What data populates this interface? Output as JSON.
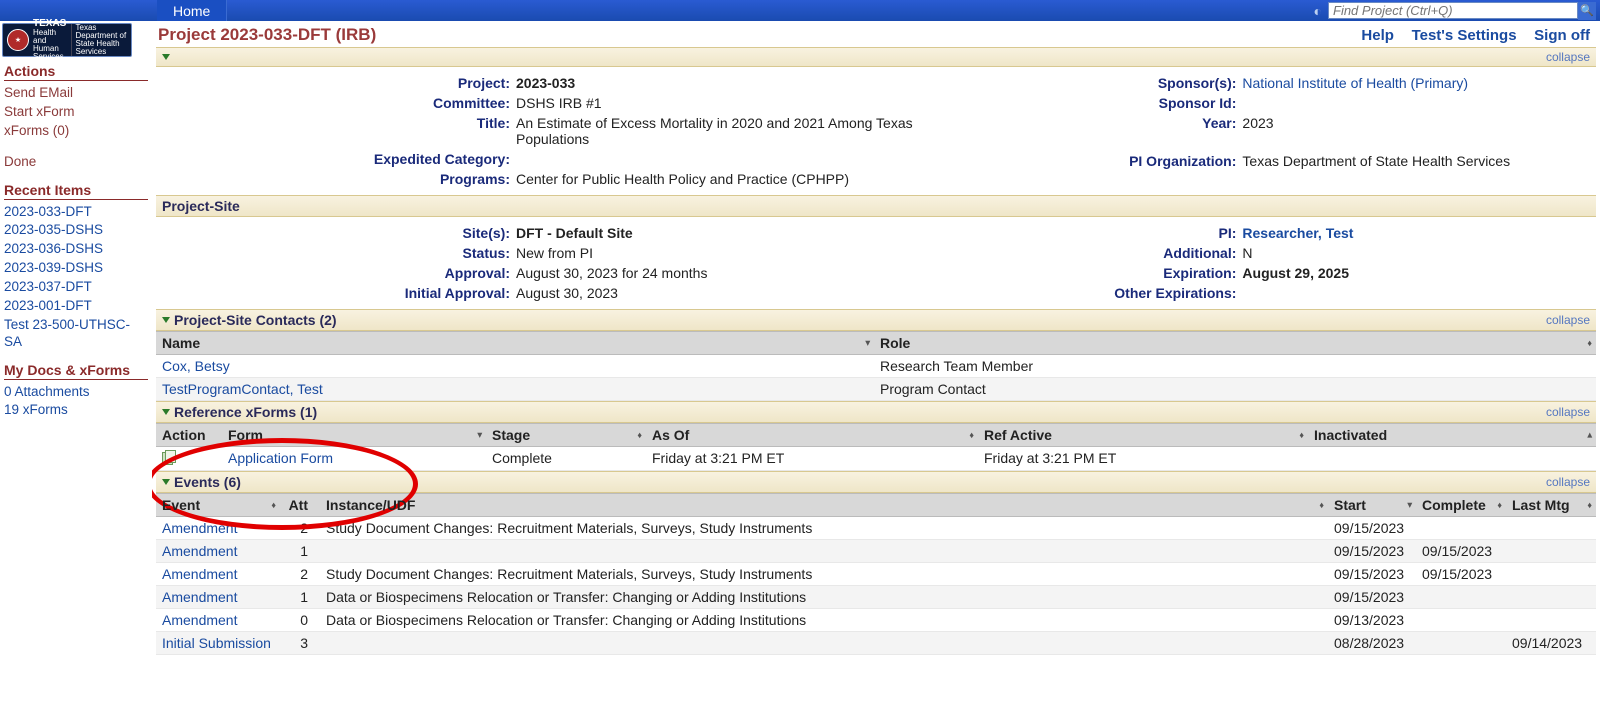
{
  "topbar": {
    "home": "Home",
    "search_placeholder": "Find Project (Ctrl+Q)"
  },
  "logo": {
    "line1": "TEXAS",
    "line2": "Health and Human Services",
    "line3": "Texas Department of State Health Services"
  },
  "titlebar": {
    "title": "Project 2023-033-DFT (IRB)",
    "help": "Help",
    "settings": "Test's Settings",
    "signoff": "Sign off"
  },
  "sidebar": {
    "actions_header": "Actions",
    "actions": [
      "Send EMail",
      "Start xForm",
      "xForms (0)",
      "Done"
    ],
    "recent_header": "Recent Items",
    "recent": [
      "2023-033-DFT",
      "2023-035-DSHS",
      "2023-036-DSHS",
      "2023-039-DSHS",
      "2023-037-DFT",
      "2023-001-DFT",
      "Test 23-500-UTHSC-SA"
    ],
    "docs_header": "My Docs & xForms",
    "docs": [
      "0 Attachments",
      "19 xForms"
    ]
  },
  "collapse_label": "collapse",
  "project": {
    "labels": {
      "project": "Project:",
      "committee": "Committee:",
      "title": "Title:",
      "expedited": "Expedited Category:",
      "programs": "Programs:",
      "sponsors": "Sponsor(s):",
      "sponsor_id": "Sponsor Id:",
      "year": "Year:",
      "pi_org": "PI Organization:"
    },
    "project": "2023-033",
    "committee": "DSHS IRB #1",
    "title": "An Estimate of Excess Mortality in 2020 and 2021 Among Texas Populations",
    "expedited": "",
    "programs": "Center for Public Health Policy and Practice (CPHPP)",
    "sponsors": "National Institute of Health (Primary)",
    "sponsor_id": "",
    "year": "2023",
    "pi_org": "Texas Department of State Health Services"
  },
  "project_site_header": "Project-Site",
  "site": {
    "labels": {
      "sites": "Site(s):",
      "status": "Status:",
      "approval": "Approval:",
      "initial": "Initial Approval:",
      "pi": "PI:",
      "additional": "Additional:",
      "expiration": "Expiration:",
      "other_exp": "Other Expirations:"
    },
    "sites": "DFT - Default Site",
    "status": "New from PI",
    "approval": "August 30, 2023 for 24 months",
    "initial": "August 30, 2023",
    "pi": "Researcher, Test",
    "additional": "N",
    "expiration": "August 29, 2025",
    "other_exp": ""
  },
  "contacts": {
    "header": "Project-Site Contacts (2)",
    "cols": {
      "name": "Name",
      "role": "Role"
    },
    "rows": [
      {
        "name": "Cox, Betsy",
        "role": "Research Team Member"
      },
      {
        "name": "TestProgramContact, Test",
        "role": "Program Contact"
      }
    ]
  },
  "refforms": {
    "header": "Reference xForms (1)",
    "cols": {
      "action": "Action",
      "form": "Form",
      "stage": "Stage",
      "asof": "As Of",
      "refactive": "Ref Active",
      "inactivated": "Inactivated"
    },
    "rows": [
      {
        "form": "Application Form",
        "stage": "Complete",
        "asof": "Friday at 3:21 PM ET",
        "refactive": "Friday at 3:21 PM ET",
        "inactivated": ""
      }
    ]
  },
  "events": {
    "header": "Events (6)",
    "cols": {
      "event": "Event",
      "att": "Att",
      "inst": "Instance/UDF",
      "start": "Start",
      "complete": "Complete",
      "lastmtg": "Last Mtg"
    },
    "rows": [
      {
        "event": "Amendment",
        "att": "2",
        "inst": "Study Document Changes: Recruitment Materials, Surveys, Study Instruments",
        "start": "09/15/2023",
        "complete": "",
        "lastmtg": ""
      },
      {
        "event": "Amendment",
        "att": "1",
        "inst": "",
        "start": "09/15/2023",
        "complete": "09/15/2023",
        "lastmtg": ""
      },
      {
        "event": "Amendment",
        "att": "2",
        "inst": "Study Document Changes: Recruitment Materials, Surveys, Study Instruments",
        "start": "09/15/2023",
        "complete": "09/15/2023",
        "lastmtg": ""
      },
      {
        "event": "Amendment",
        "att": "1",
        "inst": "Data or Biospecimens Relocation or Transfer: Changing or Adding Institutions",
        "start": "09/15/2023",
        "complete": "",
        "lastmtg": ""
      },
      {
        "event": "Amendment",
        "att": "0",
        "inst": "Data or Biospecimens Relocation or Transfer: Changing or Adding Institutions",
        "start": "09/13/2023",
        "complete": "",
        "lastmtg": ""
      },
      {
        "event": "Initial Submission",
        "att": "3",
        "inst": "",
        "start": "08/28/2023",
        "complete": "",
        "lastmtg": "09/14/2023"
      }
    ]
  }
}
